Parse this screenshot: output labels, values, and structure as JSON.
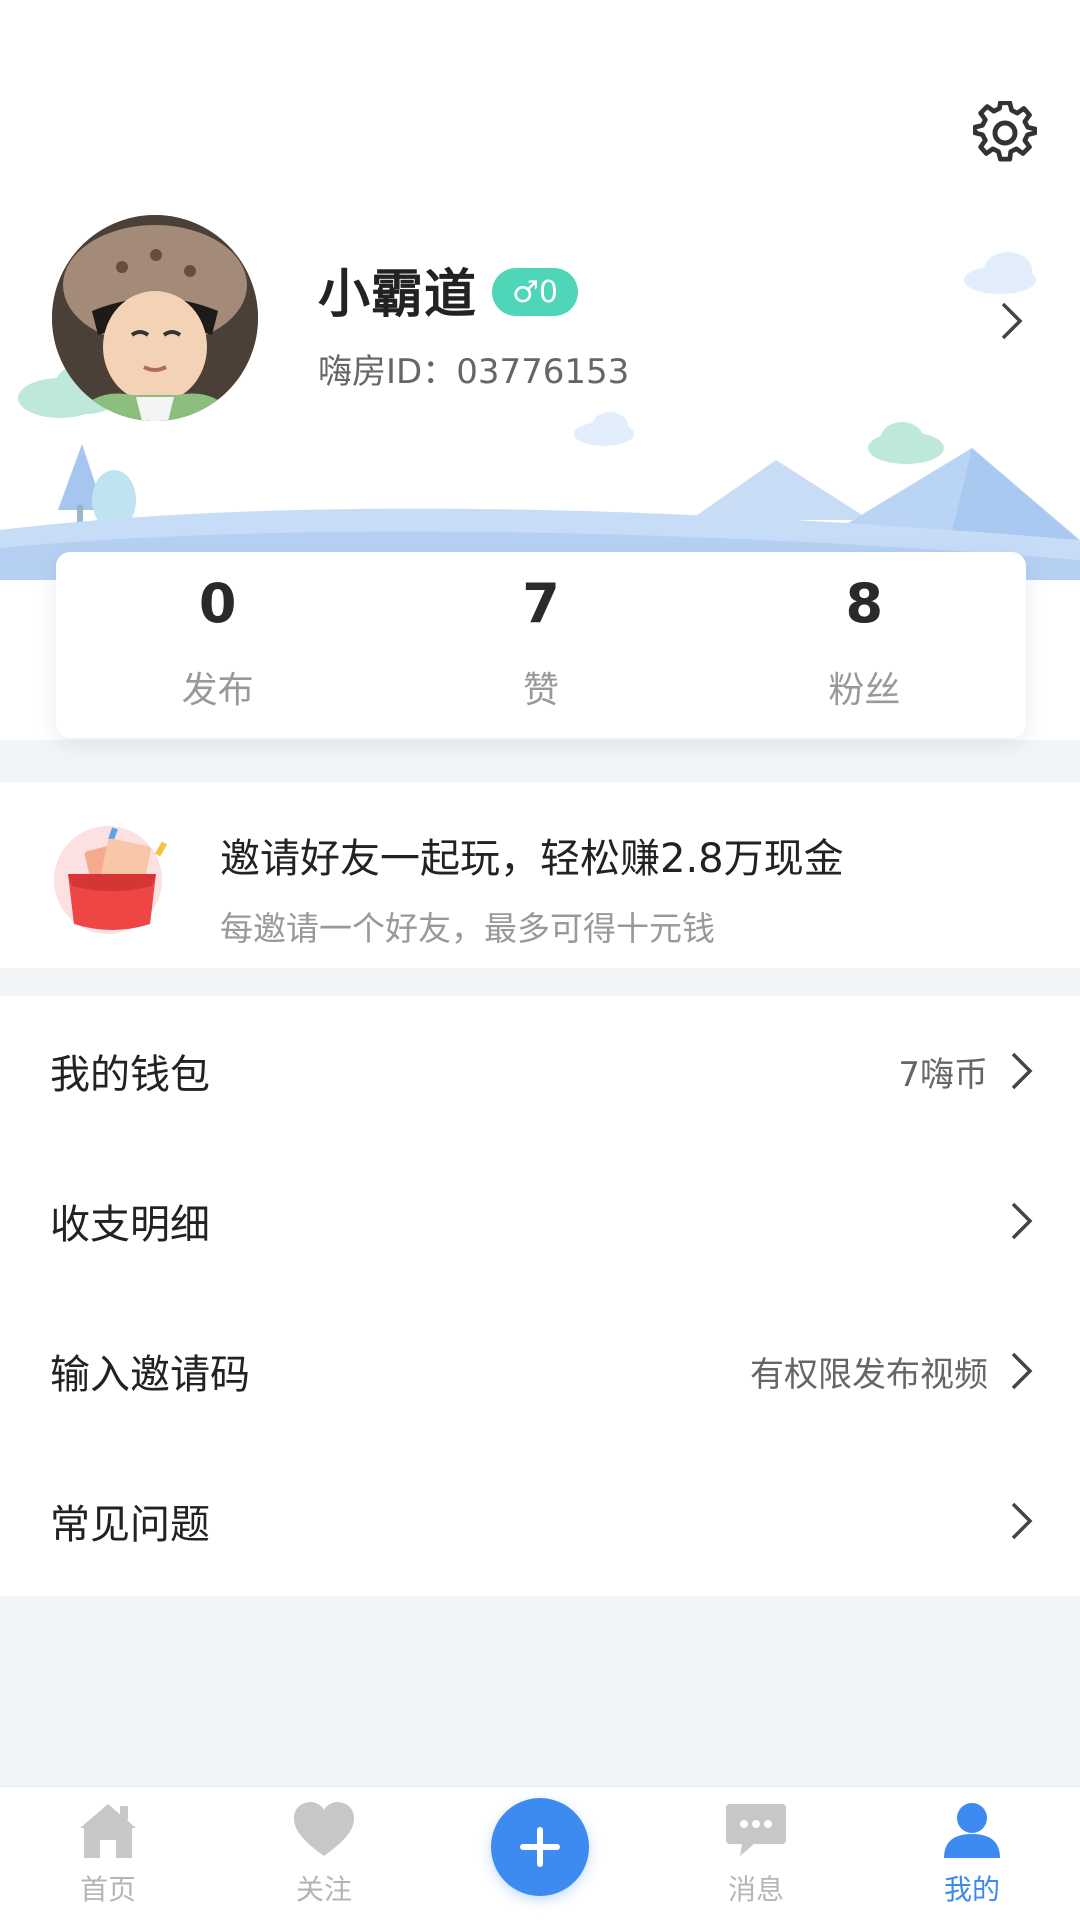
{
  "profile": {
    "username": "小霸道",
    "gender_badge": "♂0",
    "user_id": "嗨房ID：03776153"
  },
  "stats": [
    {
      "value": "0",
      "label": "发布"
    },
    {
      "value": "7",
      "label": "赞"
    },
    {
      "value": "8",
      "label": "粉丝"
    }
  ],
  "invite": {
    "title": "邀请好友一起玩，轻松赚2.8万现金",
    "subtitle": "每邀请一个好友，最多可得十元钱"
  },
  "menu": [
    {
      "label": "我的钱包",
      "value": "7嗨币"
    },
    {
      "label": "收支明细",
      "value": ""
    },
    {
      "label": "输入邀请码",
      "value": "有权限发布视频"
    },
    {
      "label": "常见问题",
      "value": ""
    }
  ],
  "tabs": [
    {
      "label": "首页",
      "icon": "home-icon"
    },
    {
      "label": "关注",
      "icon": "heart-icon"
    },
    {
      "label": "",
      "icon": "plus-icon"
    },
    {
      "label": "消息",
      "icon": "message-icon"
    },
    {
      "label": "我的",
      "icon": "user-icon"
    }
  ],
  "colors": {
    "accent": "#3d8bf0",
    "badge": "#4fd5b8",
    "scenery_blue": "#b9d4f4",
    "cloud_green": "#bde8da"
  }
}
